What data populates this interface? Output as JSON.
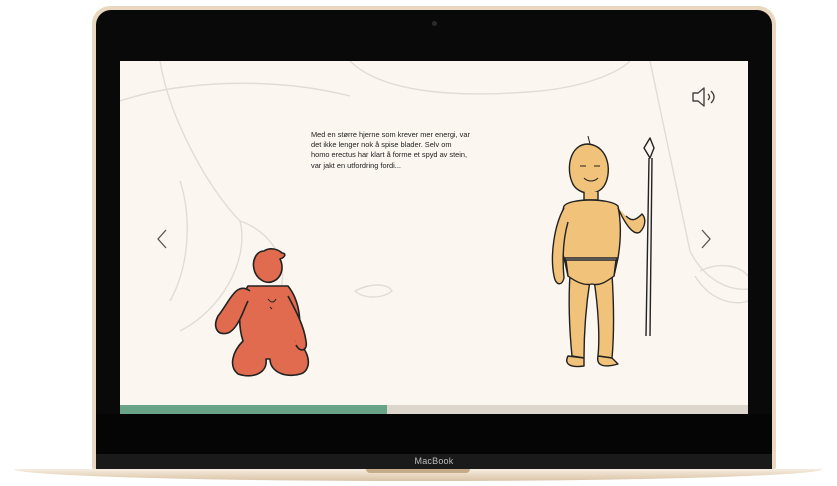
{
  "device": {
    "brand_label": "MacBook"
  },
  "story": {
    "paragraph": "Med en større hjerne som krever mer energi, var det ikke lenger nok å spise blader. Selv om homo erectus har klart å forme et spyd av stein, var jakt en utfordring fordi..."
  },
  "controls": {
    "prev_icon": "chevron-left-icon",
    "next_icon": "chevron-right-icon",
    "sound_icon": "speaker-icon"
  },
  "progress": {
    "fraction": 0.425
  },
  "colors": {
    "background": "#fbf6ef",
    "progress_fill": "#6aa488",
    "progress_track": "#ddd6cc",
    "ape": "#e06b4e",
    "homo_erectus": "#f1c27a"
  }
}
